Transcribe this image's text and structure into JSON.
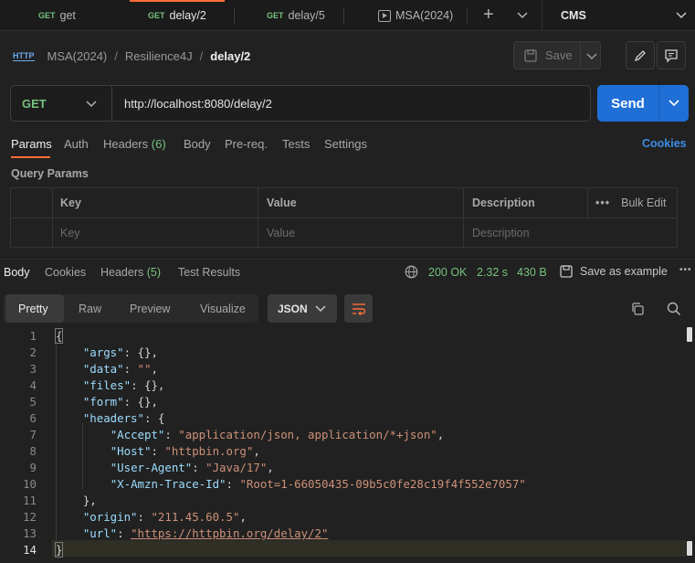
{
  "tabs": [
    {
      "method": "GET",
      "label": "get"
    },
    {
      "method": "GET",
      "label": "delay/2",
      "active": true
    },
    {
      "method": "GET",
      "label": "delay/5"
    },
    {
      "method": "",
      "label": "MSA(2024)"
    }
  ],
  "environment": "CMS",
  "breadcrumb": {
    "collection": "MSA(2024)",
    "folder": "Resilience4J",
    "request": "delay/2"
  },
  "toolbar": {
    "save_label": "Save"
  },
  "request": {
    "method": "GET",
    "url": "http://localhost:8080/delay/2",
    "send_label": "Send"
  },
  "request_tabs": {
    "params": "Params",
    "auth": "Auth",
    "headers": "Headers",
    "headers_count": "(6)",
    "body": "Body",
    "prereq": "Pre-req.",
    "tests": "Tests",
    "settings": "Settings",
    "cookies": "Cookies"
  },
  "query_params": {
    "title": "Query Params",
    "columns": {
      "key": "Key",
      "value": "Value",
      "description": "Description",
      "bulk_edit": "Bulk Edit"
    },
    "placeholders": {
      "key": "Key",
      "value": "Value",
      "description": "Description"
    }
  },
  "response": {
    "tabs": {
      "body": "Body",
      "cookies": "Cookies",
      "headers": "Headers",
      "headers_count": "(5)",
      "test_results": "Test Results"
    },
    "status": "200 OK",
    "time": "2.32 s",
    "size": "430 B",
    "save_example": "Save as example",
    "views": {
      "pretty": "Pretty",
      "raw": "Raw",
      "preview": "Preview",
      "visualize": "Visualize"
    },
    "format": "JSON"
  },
  "code_lines": [
    "1",
    "2",
    "3",
    "4",
    "5",
    "6",
    "7",
    "8",
    "9",
    "10",
    "11",
    "12",
    "13",
    "14"
  ],
  "json_body": {
    "args": "\"args\"",
    "data": "\"data\"",
    "data_val": "\"\"",
    "files": "\"files\"",
    "form": "\"form\"",
    "headers": "\"headers\"",
    "accept": "\"Accept\"",
    "accept_val": "\"application/json, application/*+json\"",
    "host": "\"Host\"",
    "host_val": "\"httpbin.org\"",
    "ua": "\"User-Agent\"",
    "ua_val": "\"Java/17\"",
    "trace": "\"X-Amzn-Trace-Id\"",
    "trace_val": "\"Root=1-66050435-09b5c0fe28c19f4f552e7057\"",
    "origin": "\"origin\"",
    "origin_val": "\"211.45.60.5\"",
    "url": "\"url\"",
    "url_val": "\"https://httpbin.org/delay/2\""
  }
}
